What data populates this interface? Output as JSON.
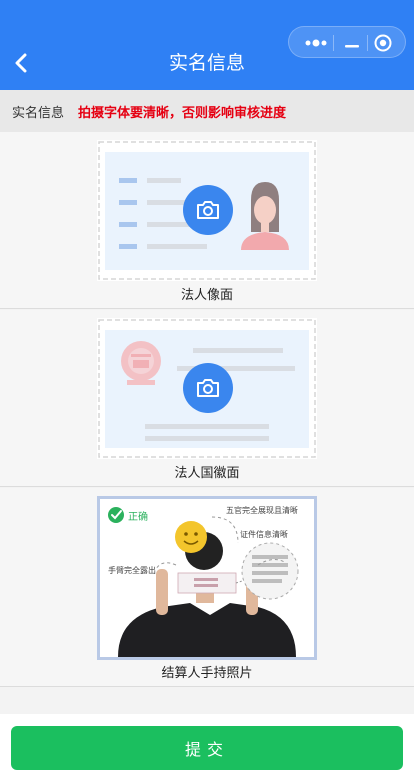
{
  "header": {
    "title": "实名信息",
    "back_icon": "chevron-left-icon"
  },
  "capsule": {
    "more_icon": "more-dots-icon",
    "minimize_icon": "minimize-icon",
    "close_icon": "target-circle-icon"
  },
  "notice": {
    "label": "实名信息",
    "warning": "拍摄字体要清晰，否则影响审核进度"
  },
  "uploads": [
    {
      "caption": "法人像面",
      "icon": "camera-icon"
    },
    {
      "caption": "法人国徽面",
      "icon": "camera-icon"
    },
    {
      "caption": "结算人手持照片"
    }
  ],
  "example": {
    "correct": "正确",
    "note1": "五官完全展现且清晰",
    "note2": "证件信息清晰",
    "note3": "手臂完全露出"
  },
  "submit_label": "提交",
  "colors": {
    "brand_blue": "#2f80f4",
    "submit_green": "#1bbf5f",
    "warning_red": "#e60012"
  }
}
